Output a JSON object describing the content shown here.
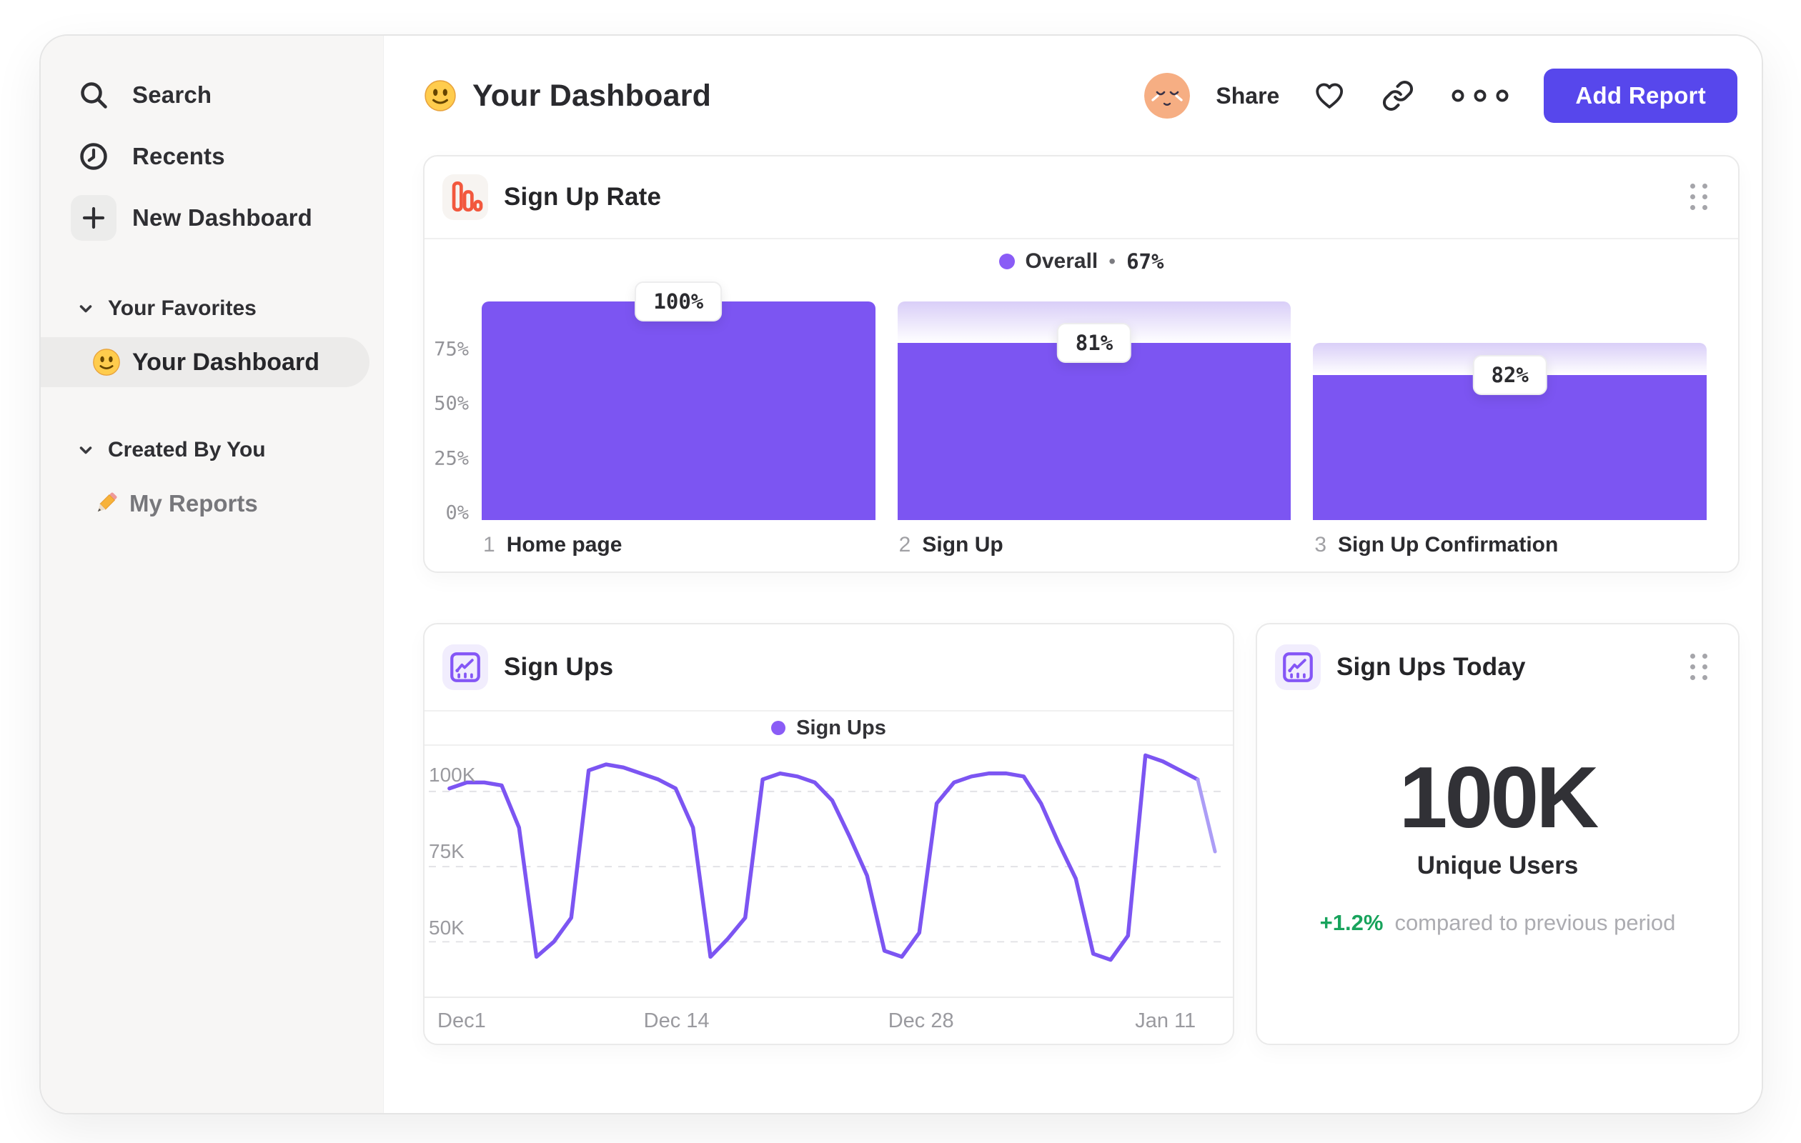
{
  "theme": {
    "accent_purple": "#7C55F2",
    "legend_dot_purple": "#8A5CF6",
    "button_purple": "#5747EC",
    "icon_orange": "#F2583E",
    "positive_green": "#18A35C",
    "faded_line_purple": "#AC9DF6",
    "gradient_top_purple": "#D9CEF8"
  },
  "sidebar": {
    "nav": [
      {
        "label": "Search",
        "icon": "search-icon"
      },
      {
        "label": "Recents",
        "icon": "clock-icon"
      },
      {
        "label": "New Dashboard",
        "icon": "plus-icon"
      }
    ],
    "sections": [
      {
        "title": "Your Favorites",
        "items": [
          {
            "label": "Your Dashboard",
            "emoji": "slightly-smiling-face",
            "selected": true
          }
        ]
      },
      {
        "title": "Created By You",
        "items": [
          {
            "label": "My Reports",
            "emoji": "pencil",
            "selected": false
          }
        ]
      }
    ]
  },
  "header": {
    "title": "Your Dashboard",
    "title_emoji": "slightly-smiling-face",
    "share_label": "Share",
    "add_report_label": "Add Report"
  },
  "cards": {
    "funnel": {
      "title": "Sign Up Rate"
    },
    "line": {
      "title": "Sign Ups"
    },
    "metric": {
      "title": "Sign Ups Today",
      "value": "100K",
      "label": "Unique Users",
      "delta": "+1.2%",
      "delta_note": "compared to previous period"
    }
  },
  "chart_data": [
    {
      "id": "signup-rate-funnel",
      "type": "bar",
      "subtype": "funnel",
      "title": "Sign Up Rate",
      "legend": {
        "series": "Overall",
        "separator": "•",
        "value": "67%",
        "position": "top-center"
      },
      "y_ticks": [
        {
          "label": "0%",
          "pct": 0
        },
        {
          "label": "25%",
          "pct": 25
        },
        {
          "label": "50%",
          "pct": 50
        },
        {
          "label": "75%",
          "pct": 75
        }
      ],
      "ylim": [
        0,
        100
      ],
      "grid": false,
      "steps": [
        {
          "step": 1,
          "category": "Home page",
          "label": "100%",
          "conversion_from_previous_pct": 100,
          "pct_of_total": 100
        },
        {
          "step": 2,
          "category": "Sign Up",
          "label": "81%",
          "conversion_from_previous_pct": 81,
          "pct_of_total": 81
        },
        {
          "step": 3,
          "category": "Sign Up Confirmation",
          "label": "82%",
          "conversion_from_previous_pct": 82,
          "pct_of_total": 66.4
        }
      ]
    },
    {
      "id": "signups-line",
      "type": "line",
      "title": "Sign Ups",
      "legend": {
        "series": "Sign Ups",
        "position": "top-center"
      },
      "unit": "K",
      "grid": "dashed-horizontal",
      "y_ticks": [
        {
          "label": "100K",
          "value": 100
        },
        {
          "label": "75K",
          "value": 75
        },
        {
          "label": "50K",
          "value": 50
        }
      ],
      "ylim_displayed": [
        31,
        115
      ],
      "x_ticks": [
        {
          "label": "Dec1",
          "index": 0
        },
        {
          "label": "Dec 14",
          "index": 13
        },
        {
          "label": "Dec 28",
          "index": 27
        },
        {
          "label": "Jan 11",
          "index": 41
        }
      ],
      "values_k": [
        101,
        103,
        103,
        102,
        88,
        45,
        50,
        58,
        107,
        109,
        108,
        106,
        104,
        101,
        88,
        45,
        51,
        58,
        104,
        106,
        105,
        103,
        97,
        85,
        72,
        47,
        45,
        53,
        96,
        103,
        105,
        106,
        106,
        105,
        96,
        83,
        71,
        46,
        44,
        52,
        112,
        110,
        107,
        104,
        80
      ],
      "incomplete_tail_segments": 1
    },
    {
      "id": "signups-today-metric",
      "type": "metric",
      "title": "Sign Ups Today",
      "value": "100K",
      "label": "Unique Users",
      "delta_pct": "+1.2%",
      "comparison": "compared to previous period"
    }
  ]
}
